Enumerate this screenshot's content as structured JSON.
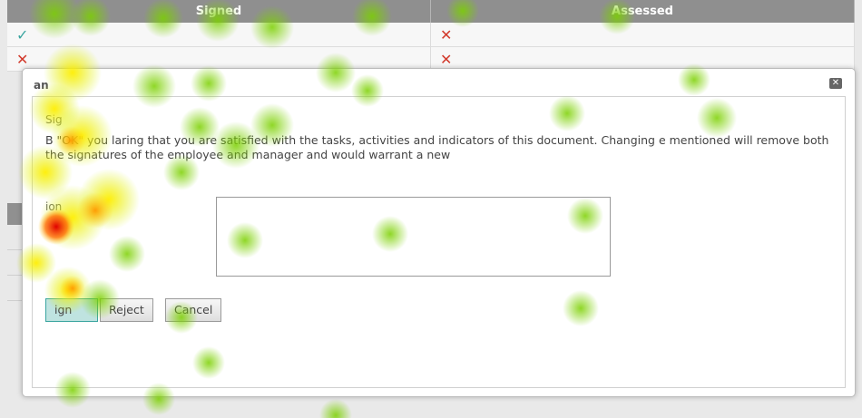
{
  "grid": {
    "columns": [
      "Signed",
      "Assessed"
    ],
    "rows": [
      {
        "signed_icon": "✓",
        "assessed_icon": "✕"
      },
      {
        "signed_icon": "✕",
        "assessed_icon": "✕"
      }
    ]
  },
  "dialog": {
    "title": "an",
    "close_icon": "✕",
    "section_label": "Sig",
    "message": "B \"OK\" you laring that you are satisfied with the tasks, activities and indicators of this document. Changing e mentioned will remove both the signatures of the employee and manager and would warrant a new",
    "comment_label": "ion",
    "comment_value": "",
    "buttons": {
      "sign": "ign",
      "reject": "Reject",
      "cancel": "Cancel"
    }
  },
  "colors": {
    "accent": "#3aa5a0",
    "error": "#d23a2c",
    "header_bg": "#8f8f8f"
  }
}
